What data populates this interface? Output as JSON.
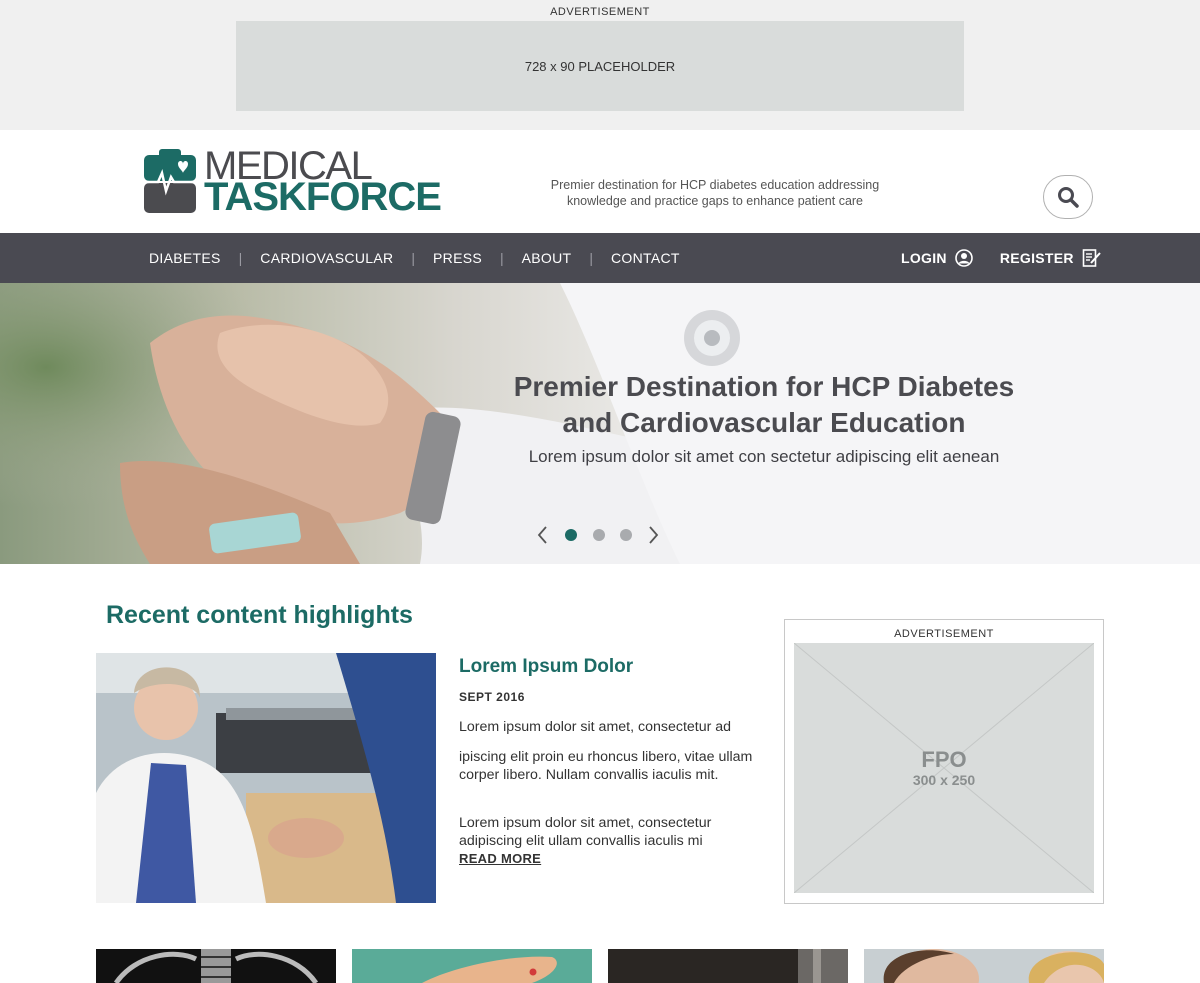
{
  "top_ad": {
    "label": "ADVERTISEMENT",
    "placeholder": "728 x 90 PLACEHOLDER"
  },
  "header": {
    "logo_line1": "MEDICAL",
    "logo_line2": "TASKFORCE",
    "tagline_line1": "Premier destination for HCP diabetes education addressing",
    "tagline_line2": "knowledge and practice gaps to enhance patient care"
  },
  "nav": {
    "items": [
      "DIABETES",
      "CARDIOVASCULAR",
      "PRESS",
      "ABOUT",
      "CONTACT"
    ],
    "separator": "|",
    "login": "LOGIN",
    "register": "REGISTER"
  },
  "hero": {
    "title_line1": "Premier Destination for HCP Diabetes",
    "title_line2": "and Cardiovascular Education",
    "subtitle": "Lorem ipsum dolor sit amet con sectetur adipiscing elit aenean",
    "slides": 3,
    "active_slide": 1
  },
  "highlights": {
    "section_title": "Recent content highlights",
    "article": {
      "title": "Lorem Ipsum Dolor",
      "date": "SEPT 2016",
      "p1": "Lorem ipsum dolor sit amet, consectetur ad",
      "p2": "ipiscing elit proin eu rhoncus libero, vitae ullam corper libero. Nullam convallis iaculis mit.",
      "p3": "Lorem ipsum dolor sit amet, consectetur adipiscing elit ullam convallis iaculis mi",
      "read_more": "READ MORE"
    }
  },
  "side_ad": {
    "label": "ADVERTISEMENT",
    "fpo": "FPO",
    "size": "300 x 250"
  },
  "colors": {
    "brand_teal": "#1c6b65",
    "nav_bg": "#4a4a52",
    "logo_gray": "#4b4b4f"
  }
}
